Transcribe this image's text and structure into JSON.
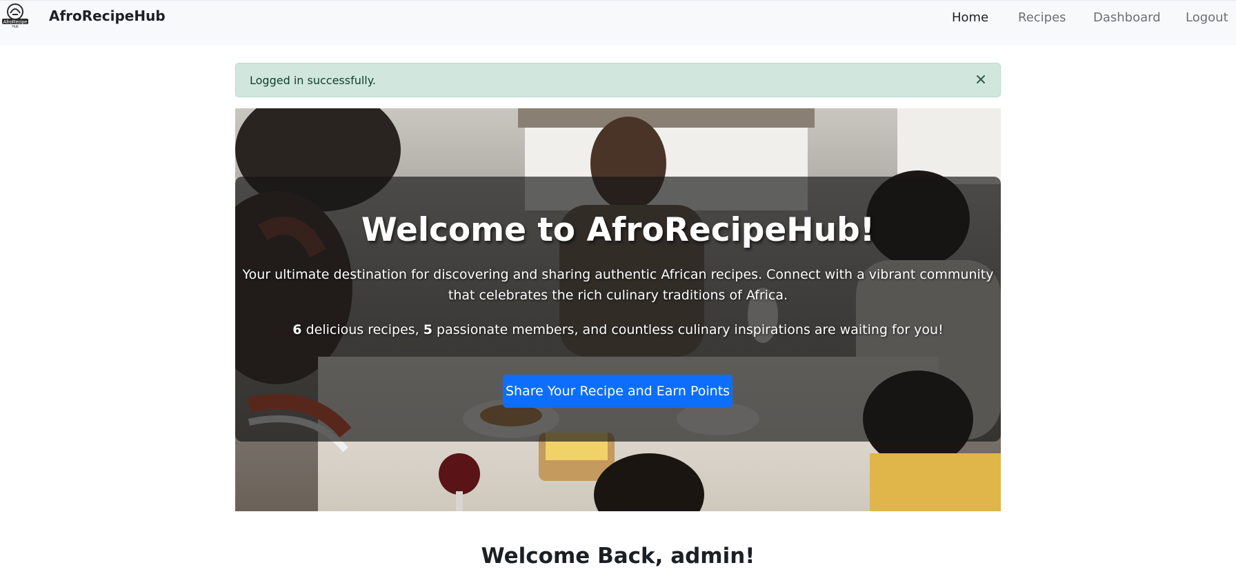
{
  "navbar": {
    "brand": "AfroRecipeHub",
    "logo_text": "AfroRecipe Hub",
    "links": [
      {
        "label": "Home",
        "active": true
      },
      {
        "label": "Recipes",
        "active": false
      },
      {
        "label": "Dashboard",
        "active": false
      },
      {
        "label": "Logout",
        "active": false
      }
    ]
  },
  "alert": {
    "message": "Logged in successfully.",
    "close_icon": "close-icon",
    "color": "#d1e7dd"
  },
  "hero": {
    "title": "Welcome to AfroRecipeHub!",
    "description_line1": "Your ultimate destination for discovering and sharing authentic African recipes. Connect with a vibrant community",
    "description_line2": "that celebrates the rich culinary traditions of Africa.",
    "recipe_count": "6",
    "stats_part1": " delicious recipes, ",
    "member_count": "5",
    "stats_part2": " passionate members, and countless culinary inspirations are waiting for you!",
    "cta_label": "Share Your Recipe and Earn Points",
    "cta_color": "#0d6efd"
  },
  "welcome": {
    "heading": "Welcome Back, admin!"
  }
}
